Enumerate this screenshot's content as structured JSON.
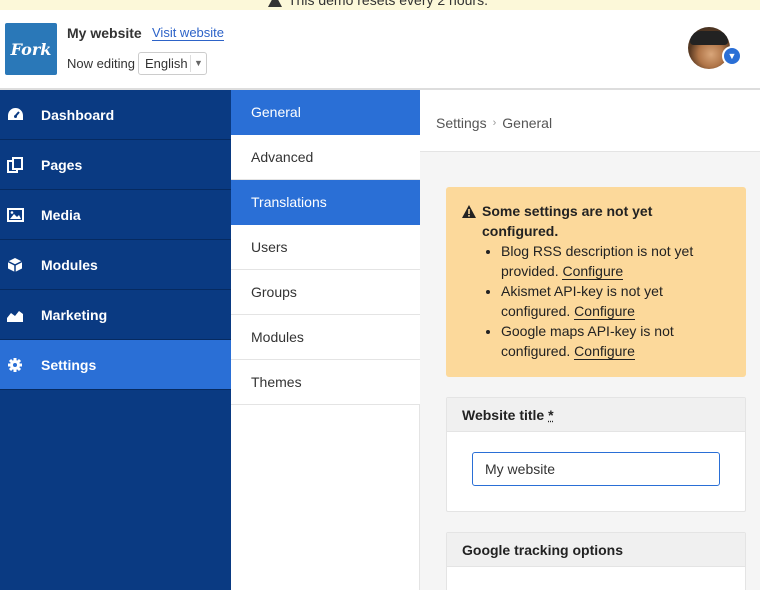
{
  "banner": {
    "text": "This demo resets every 2 hours."
  },
  "header": {
    "logo_text": "Fork",
    "site_name": "My website",
    "visit_link": "Visit website",
    "now_editing_label": "Now editing",
    "language": "English"
  },
  "nav": {
    "items": [
      {
        "label": "Dashboard",
        "icon": "dashboard-icon"
      },
      {
        "label": "Pages",
        "icon": "pages-icon"
      },
      {
        "label": "Media",
        "icon": "image-icon"
      },
      {
        "label": "Modules",
        "icon": "cube-icon"
      },
      {
        "label": "Marketing",
        "icon": "chart-icon"
      },
      {
        "label": "Settings",
        "icon": "gear-icon",
        "active": true
      }
    ]
  },
  "subnav": {
    "items": [
      {
        "label": "General",
        "active": true
      },
      {
        "label": "Advanced"
      },
      {
        "label": "Translations",
        "active": true
      },
      {
        "label": "Users"
      },
      {
        "label": "Groups"
      },
      {
        "label": "Modules"
      },
      {
        "label": "Themes"
      }
    ]
  },
  "breadcrumb": {
    "root": "Settings",
    "separator": "›",
    "current": "General"
  },
  "warning": {
    "title": "Some settings are not yet configured.",
    "items": [
      {
        "text": "Blog RSS description is not yet provided.",
        "link": "Configure"
      },
      {
        "text": "Akismet API-key is not yet configured.",
        "link": "Configure"
      },
      {
        "text": "Google maps API-key is not configured.",
        "link": "Configure"
      }
    ]
  },
  "website_title": {
    "label": "Website title",
    "required_mark": "*",
    "value": "My website"
  },
  "tracking": {
    "label": "Google tracking options"
  },
  "colors": {
    "nav_bg": "#0a3a82",
    "accent": "#2a6fd6",
    "warning_bg": "#fcd99b"
  }
}
